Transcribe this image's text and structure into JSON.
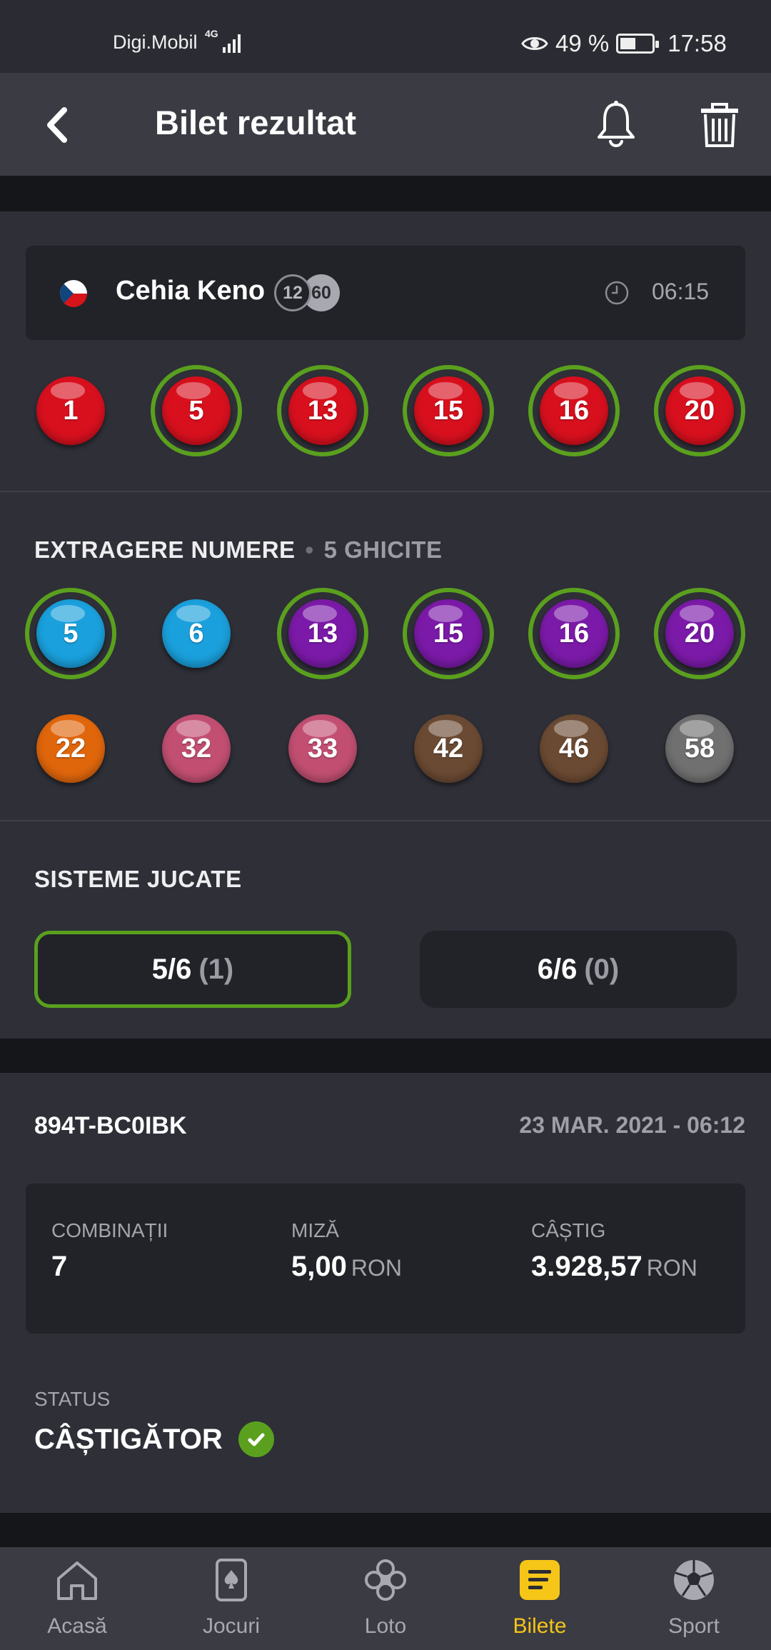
{
  "status_bar": {
    "carrier": "Digi.Mobil",
    "network": "4G",
    "battery_percent": "49 %",
    "battery_level": 0.49,
    "time": "17:58"
  },
  "header": {
    "title": "Bilet rezultat"
  },
  "game": {
    "name": "Cehia Keno",
    "badge_picks": "12",
    "badge_total": "60",
    "time": "06:15"
  },
  "played_numbers": [
    {
      "n": "1",
      "matched": false
    },
    {
      "n": "5",
      "matched": true
    },
    {
      "n": "13",
      "matched": true
    },
    {
      "n": "15",
      "matched": true
    },
    {
      "n": "16",
      "matched": true
    },
    {
      "n": "20",
      "matched": true
    }
  ],
  "draw": {
    "heading": "EXTRAGERE NUMERE",
    "guessed": "5 GHICITE",
    "numbers": [
      {
        "n": "5",
        "color": "#1aa0dc",
        "matched": true
      },
      {
        "n": "6",
        "color": "#1aa0dc",
        "matched": false
      },
      {
        "n": "13",
        "color": "#7b1aa8",
        "matched": true
      },
      {
        "n": "15",
        "color": "#7b1aa8",
        "matched": true
      },
      {
        "n": "16",
        "color": "#7b1aa8",
        "matched": true
      },
      {
        "n": "20",
        "color": "#7b1aa8",
        "matched": true
      },
      {
        "n": "22",
        "color": "#e0660c",
        "matched": false
      },
      {
        "n": "32",
        "color": "#c24f72",
        "matched": false
      },
      {
        "n": "33",
        "color": "#c24f72",
        "matched": false
      },
      {
        "n": "42",
        "color": "#6b4a33",
        "matched": false
      },
      {
        "n": "46",
        "color": "#6b4a33",
        "matched": false
      },
      {
        "n": "58",
        "color": "#707070",
        "matched": false
      }
    ]
  },
  "systems": {
    "heading": "SISTEME JUCATE",
    "items": [
      {
        "label": "5/6",
        "count": "(1)",
        "active": true
      },
      {
        "label": "6/6",
        "count": "(0)",
        "active": false
      }
    ]
  },
  "ticket": {
    "id": "894T-BC0IBK",
    "date": "23 MAR. 2021 - 06:12",
    "combinations_label": "COMBINAȚII",
    "combinations_value": "7",
    "stake_label": "MIZĂ",
    "stake_value": "5,00",
    "stake_unit": "RON",
    "win_label": "CÂȘTIG",
    "win_value": "3.928,57",
    "win_unit": "RON",
    "status_label": "STATUS",
    "status_value": "CÂȘTIGĂTOR"
  },
  "bottom_nav": [
    {
      "label": "Acasă",
      "icon": "home-icon",
      "active": false
    },
    {
      "label": "Jocuri",
      "icon": "card-icon",
      "active": false
    },
    {
      "label": "Loto",
      "icon": "clover-icon",
      "active": false
    },
    {
      "label": "Bilete",
      "icon": "ticket-icon",
      "active": true
    },
    {
      "label": "Sport",
      "icon": "soccer-ball-icon",
      "active": false
    }
  ],
  "colors": {
    "played_ball": "#d8101e",
    "match_ring": "#5aa01e",
    "accent": "#f5c518"
  }
}
